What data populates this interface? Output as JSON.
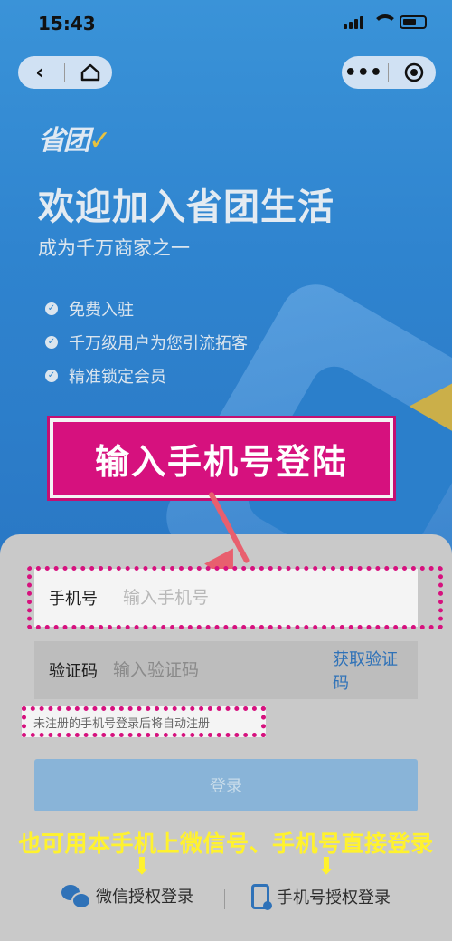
{
  "status_bar": {
    "time": "15:43"
  },
  "nav_capsule": {
    "back_icon": "chevron-left-icon",
    "home_icon": "home-icon",
    "more_icon": "more-dots-icon",
    "close_icon": "target-circle-icon"
  },
  "hero": {
    "logo_text": "省团",
    "title": "欢迎加入省团生活",
    "subtitle": "成为千万商家之一",
    "features": [
      "免费入驻",
      "千万级用户为您引流拓客",
      "精准锁定会员"
    ]
  },
  "annotation": {
    "banner": "输入手机号登陆",
    "alt_note": "也可用本手机上微信号、手机号直接登录",
    "arrow_glyph": "⬇"
  },
  "form": {
    "phone_label": "手机号",
    "phone_placeholder": "输入手机号",
    "code_label": "验证码",
    "code_placeholder": "输入验证码",
    "get_code": "获取验证码",
    "notice": "未注册的手机号登录后将自动注册",
    "login_button": "登录"
  },
  "alt_login": {
    "wechat": "微信授权登录",
    "phone": "手机号授权登录"
  },
  "colors": {
    "hero_blue": "#2f86cf",
    "annotation_magenta": "#d6117e",
    "annotation_yellow": "#fff22e",
    "link_blue": "#2f72b8"
  }
}
